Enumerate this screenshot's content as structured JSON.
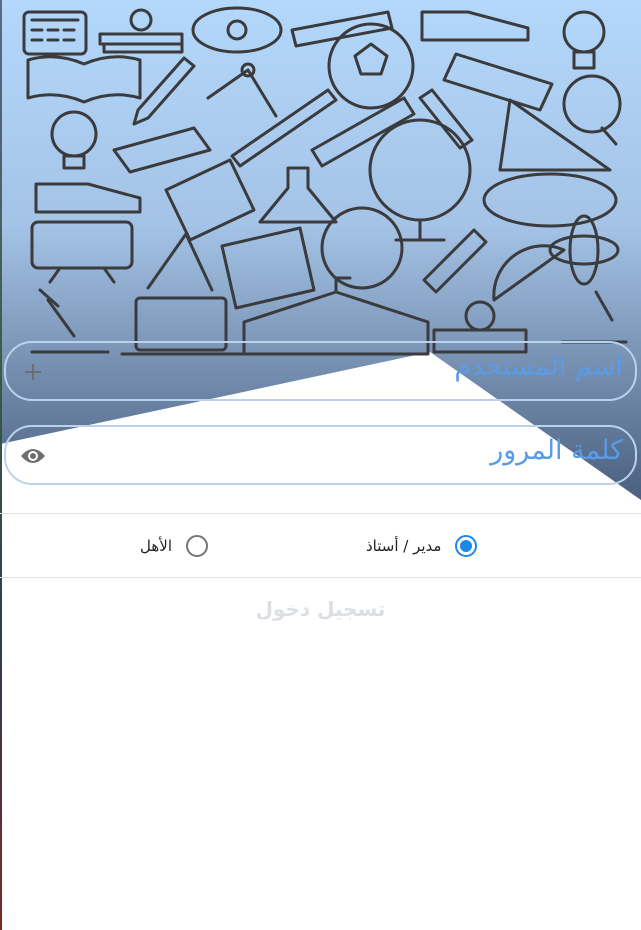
{
  "colors": {
    "header_gradient_top": "#a9cff5",
    "header_gradient_bottom": "#5d7390",
    "doodle_stroke": "#3b3b3e",
    "field_border": "#b9d3ec",
    "field_text": "#5a9be6",
    "radio_selected": "#1e88e5",
    "login_text": "#dbdee3"
  },
  "header": {
    "illustration": "school-supplies-doodle-pattern"
  },
  "form": {
    "username_placeholder": "اسم المستخدم",
    "username_icon": "plus-icon",
    "password_placeholder": "كلمة المرور",
    "password_icon": "eye-icon"
  },
  "roles": {
    "options": [
      {
        "label": "مدير / أستاذ",
        "selected": true
      },
      {
        "label": "الأهل",
        "selected": false
      }
    ]
  },
  "login_button": {
    "label": "تسجيل دخول"
  }
}
